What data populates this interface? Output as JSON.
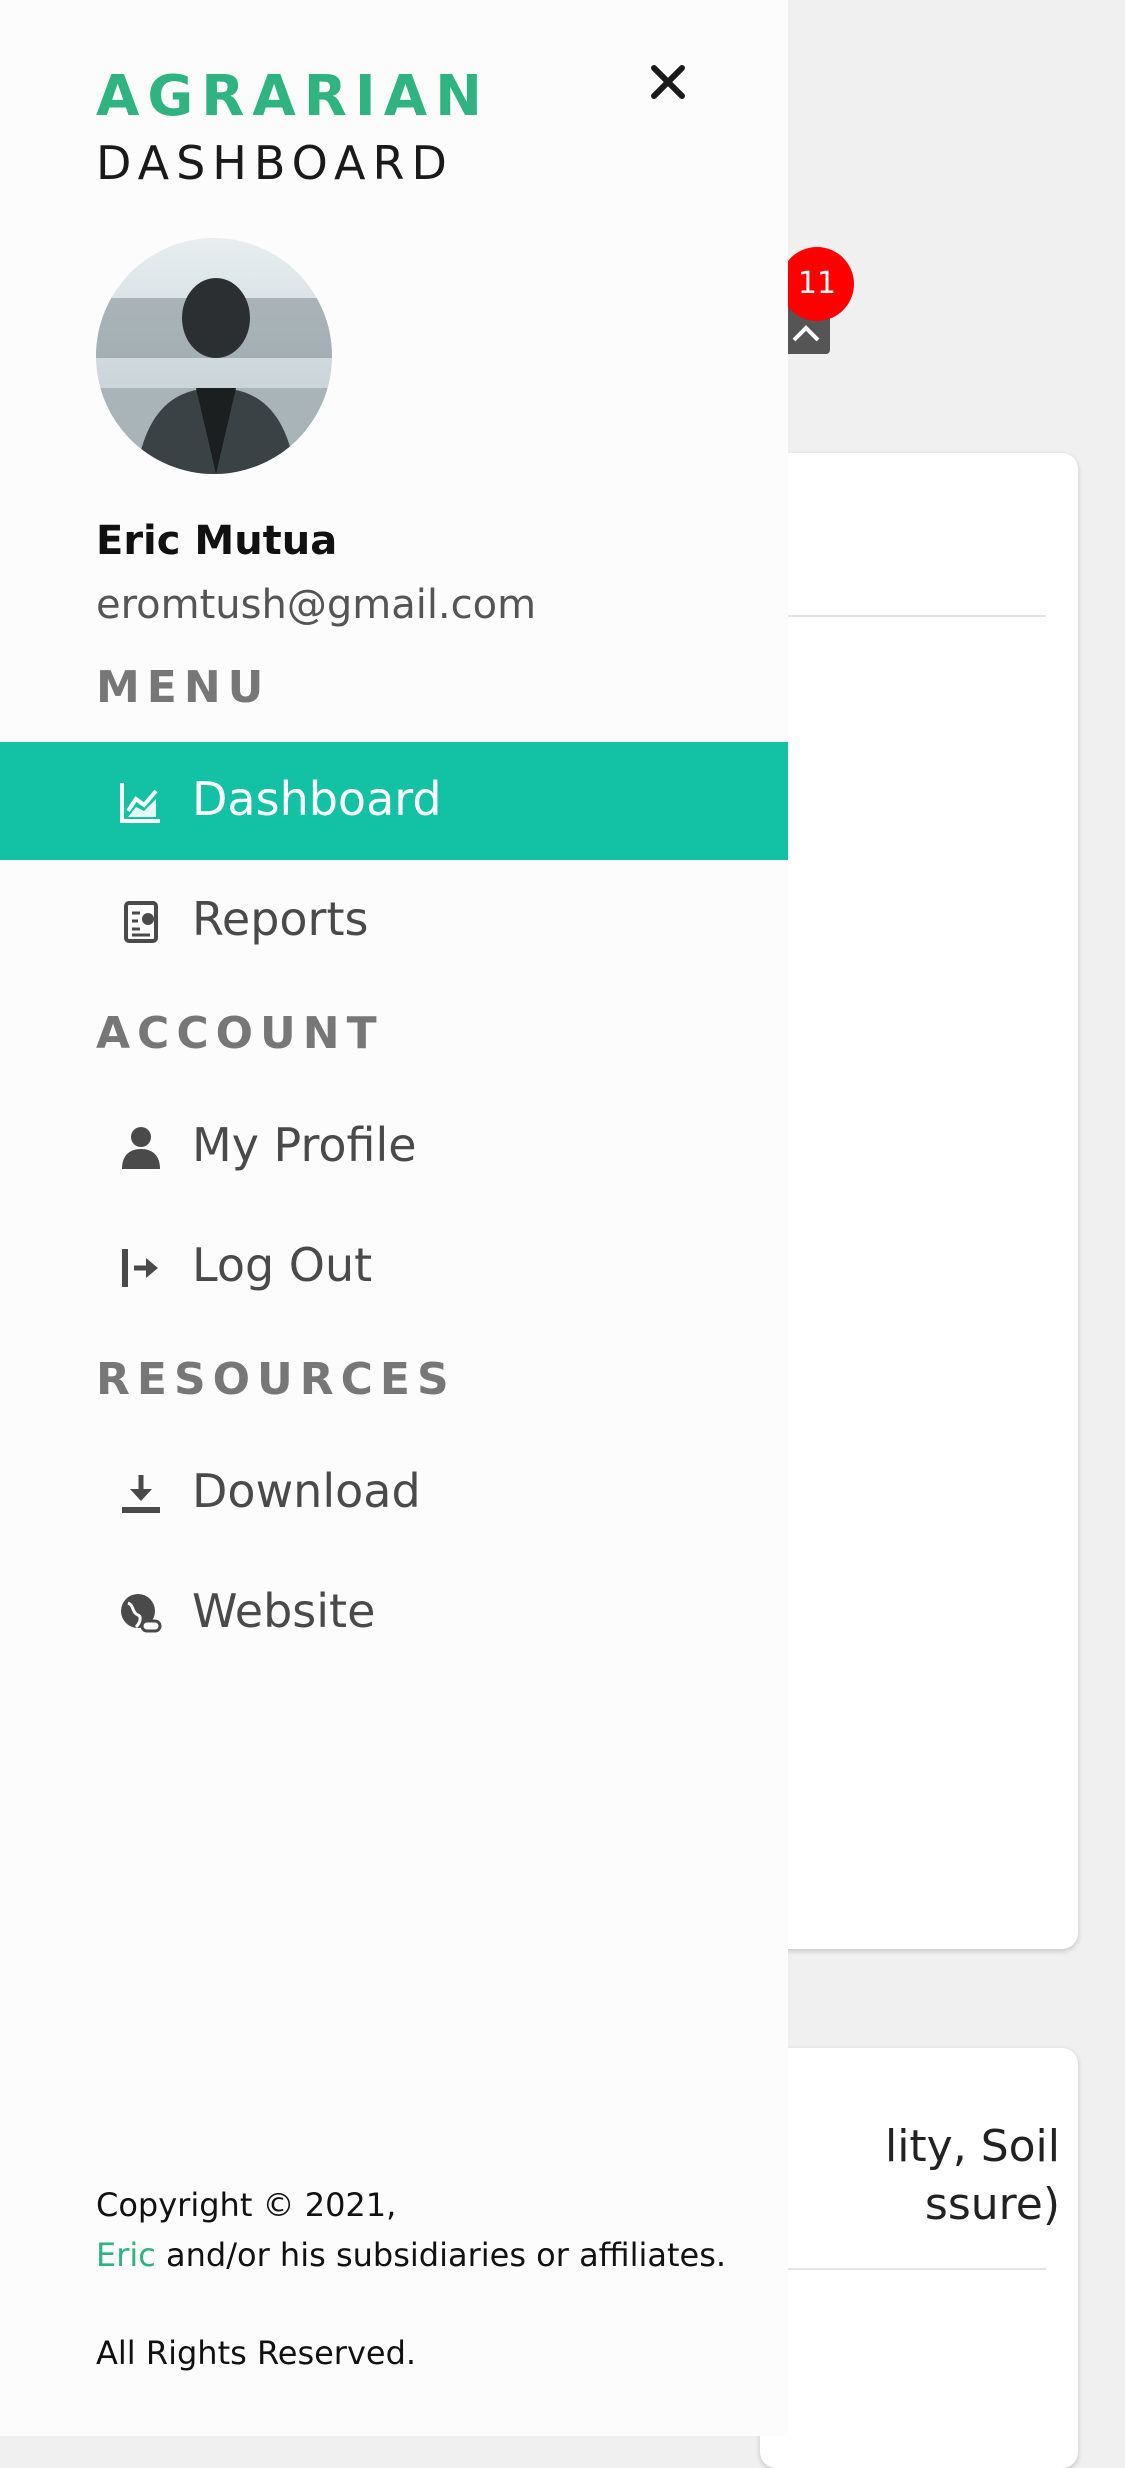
{
  "brand": {
    "line1": "AGRARIAN",
    "line2": "DASHBOARD"
  },
  "notifications": {
    "count": "11"
  },
  "user": {
    "name": "Eric Mutua",
    "email": "eromtush@gmail.com"
  },
  "sections": {
    "menu": "MENU",
    "account": "ACCOUNT",
    "resources": "RESOURCES"
  },
  "nav": {
    "dashboard": "Dashboard",
    "reports": "Reports",
    "my_profile": "My Profile",
    "log_out": "Log Out",
    "download": "Download",
    "website": "Website"
  },
  "background_card": {
    "title_fragment": "lity, Soil\nssure)"
  },
  "footer": {
    "copyright": "Copyright © 2021,",
    "owner_link": "Eric",
    "affiliates": " and/or his subsidiaries or affiliates.",
    "rights": "All Rights Reserved."
  },
  "colors": {
    "brand_green": "#2fb380",
    "active_teal": "#13c2a5",
    "badge_red": "#ff0000"
  },
  "icons": {
    "close": "close-icon",
    "dashboard": "chart-line-icon",
    "reports": "report-icon",
    "my_profile": "user-icon",
    "log_out": "logout-icon",
    "download": "download-icon",
    "website": "globe-link-icon"
  }
}
